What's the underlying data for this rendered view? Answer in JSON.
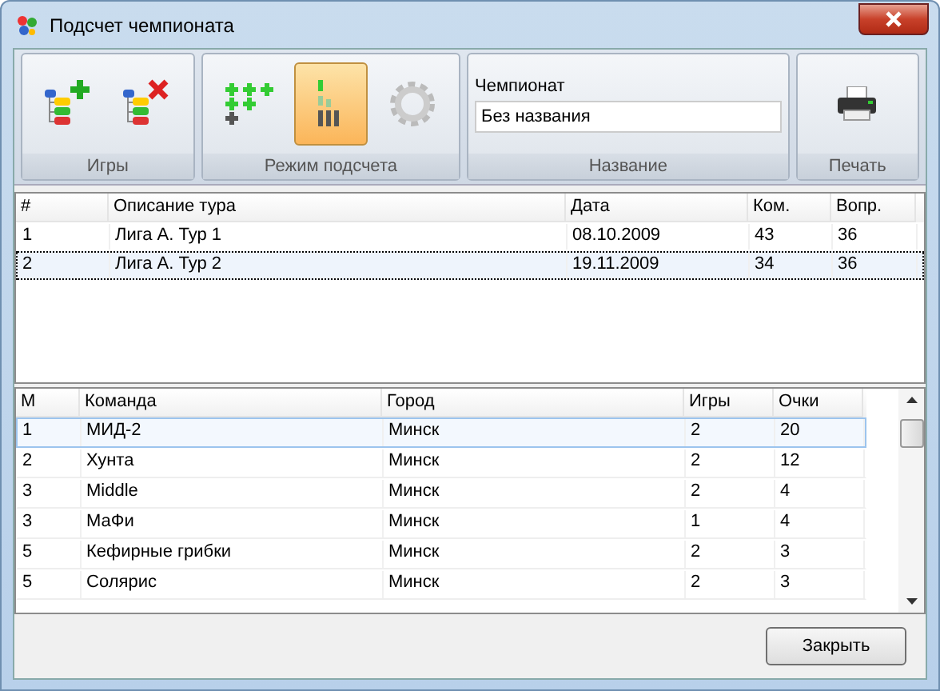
{
  "window": {
    "title": "Подсчет чемпионата"
  },
  "ribbon": {
    "games": {
      "label": "Игры",
      "buttons": [
        {
          "kind": "add"
        },
        {
          "kind": "delete"
        }
      ]
    },
    "mode": {
      "label": "Режим подсчета",
      "buttons": [
        {
          "kind": "plus",
          "selected": false
        },
        {
          "kind": "bars",
          "selected": true
        },
        {
          "kind": "gear",
          "selected": false
        }
      ]
    },
    "name": {
      "label": "Название",
      "field_label": "Чемпионат",
      "value": "Без названия"
    },
    "print": {
      "label": "Печать"
    }
  },
  "tours": {
    "columns": [
      "#",
      "Описание тура",
      "Дата",
      "Ком.",
      "Вопр."
    ],
    "rows": [
      {
        "cells": [
          "1",
          "Лига А. Тур 1",
          "08.10.2009",
          "43",
          "36"
        ],
        "selected": false
      },
      {
        "cells": [
          "2",
          "Лига А. Тур 2",
          "19.11.2009",
          "34",
          "36"
        ],
        "selected": true
      }
    ]
  },
  "standings": {
    "columns": [
      "М",
      "Команда",
      "Город",
      "Игры",
      "Очки"
    ],
    "rows": [
      {
        "cells": [
          "1",
          "МИД-2",
          "Минск",
          "2",
          "20"
        ],
        "selected": true
      },
      {
        "cells": [
          "2",
          "Хунта",
          "Минск",
          "2",
          "12"
        ],
        "selected": false
      },
      {
        "cells": [
          "3",
          "Middle",
          "Минск",
          "2",
          "4"
        ],
        "selected": false
      },
      {
        "cells": [
          "3",
          "МаФи",
          "Минск",
          "1",
          "4"
        ],
        "selected": false
      },
      {
        "cells": [
          "5",
          "Кефирные грибки",
          "Минск",
          "2",
          "3"
        ],
        "selected": false
      },
      {
        "cells": [
          "5",
          "Солярис",
          "Минск",
          "2",
          "3"
        ],
        "selected": false
      }
    ]
  },
  "buttons": [
    "Закрыть"
  ]
}
